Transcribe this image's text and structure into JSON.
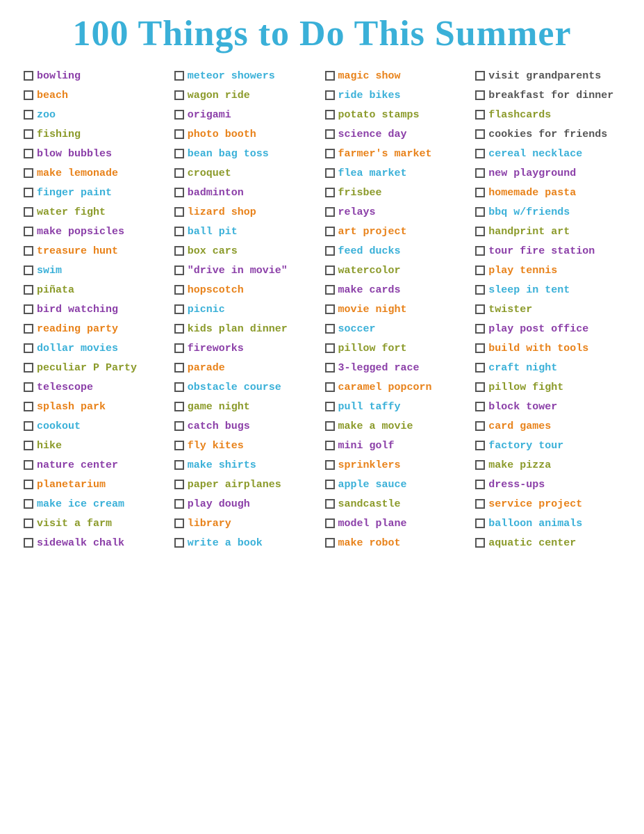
{
  "title": "100 Things to Do This Summer",
  "columns": [
    [
      {
        "label": "bowling",
        "color": "c-purple"
      },
      {
        "label": "beach",
        "color": "c-orange"
      },
      {
        "label": "zoo",
        "color": "c-teal"
      },
      {
        "label": "fishing",
        "color": "c-olive"
      },
      {
        "label": "blow bubbles",
        "color": "c-purple"
      },
      {
        "label": "make lemonade",
        "color": "c-orange"
      },
      {
        "label": "finger paint",
        "color": "c-teal"
      },
      {
        "label": "water fight",
        "color": "c-olive"
      },
      {
        "label": "make popsicles",
        "color": "c-purple"
      },
      {
        "label": "treasure hunt",
        "color": "c-orange"
      },
      {
        "label": "swim",
        "color": "c-teal"
      },
      {
        "label": "piñata",
        "color": "c-olive"
      },
      {
        "label": "bird watching",
        "color": "c-purple"
      },
      {
        "label": "reading party",
        "color": "c-orange"
      },
      {
        "label": "dollar movies",
        "color": "c-teal"
      },
      {
        "label": "peculiar P Party",
        "color": "c-olive"
      },
      {
        "label": "telescope",
        "color": "c-purple"
      },
      {
        "label": "splash park",
        "color": "c-orange"
      },
      {
        "label": "cookout",
        "color": "c-teal"
      },
      {
        "label": "hike",
        "color": "c-olive"
      },
      {
        "label": "nature center",
        "color": "c-purple"
      },
      {
        "label": "planetarium",
        "color": "c-orange"
      },
      {
        "label": "make ice cream",
        "color": "c-teal"
      },
      {
        "label": "visit a farm",
        "color": "c-olive"
      },
      {
        "label": "sidewalk chalk",
        "color": "c-purple"
      }
    ],
    [
      {
        "label": "meteor showers",
        "color": "c-teal"
      },
      {
        "label": "wagon ride",
        "color": "c-olive"
      },
      {
        "label": "origami",
        "color": "c-purple"
      },
      {
        "label": "photo booth",
        "color": "c-orange"
      },
      {
        "label": "bean bag toss",
        "color": "c-teal"
      },
      {
        "label": "croquet",
        "color": "c-olive"
      },
      {
        "label": "badminton",
        "color": "c-purple"
      },
      {
        "label": "lizard shop",
        "color": "c-orange"
      },
      {
        "label": "ball pit",
        "color": "c-teal"
      },
      {
        "label": "box cars",
        "color": "c-olive"
      },
      {
        "label": "\"drive in movie\"",
        "color": "c-purple"
      },
      {
        "label": "hopscotch",
        "color": "c-orange"
      },
      {
        "label": "picnic",
        "color": "c-teal"
      },
      {
        "label": "kids plan dinner",
        "color": "c-olive"
      },
      {
        "label": "fireworks",
        "color": "c-purple"
      },
      {
        "label": "parade",
        "color": "c-orange"
      },
      {
        "label": "obstacle course",
        "color": "c-teal"
      },
      {
        "label": "game night",
        "color": "c-olive"
      },
      {
        "label": "catch bugs",
        "color": "c-purple"
      },
      {
        "label": "fly kites",
        "color": "c-orange"
      },
      {
        "label": "make shirts",
        "color": "c-teal"
      },
      {
        "label": "paper airplanes",
        "color": "c-olive"
      },
      {
        "label": "play dough",
        "color": "c-purple"
      },
      {
        "label": "library",
        "color": "c-orange"
      },
      {
        "label": "write a book",
        "color": "c-teal"
      }
    ],
    [
      {
        "label": "magic show",
        "color": "c-orange"
      },
      {
        "label": "ride bikes",
        "color": "c-teal"
      },
      {
        "label": "potato stamps",
        "color": "c-olive"
      },
      {
        "label": "science day",
        "color": "c-purple"
      },
      {
        "label": "farmer's market",
        "color": "c-orange"
      },
      {
        "label": "flea market",
        "color": "c-teal"
      },
      {
        "label": "frisbee",
        "color": "c-olive"
      },
      {
        "label": "relays",
        "color": "c-purple"
      },
      {
        "label": "art project",
        "color": "c-orange"
      },
      {
        "label": "feed ducks",
        "color": "c-teal"
      },
      {
        "label": "watercolor",
        "color": "c-olive"
      },
      {
        "label": "make cards",
        "color": "c-purple"
      },
      {
        "label": "movie night",
        "color": "c-orange"
      },
      {
        "label": "soccer",
        "color": "c-teal"
      },
      {
        "label": "pillow fort",
        "color": "c-olive"
      },
      {
        "label": "3-legged race",
        "color": "c-purple"
      },
      {
        "label": "caramel popcorn",
        "color": "c-orange"
      },
      {
        "label": "pull taffy",
        "color": "c-teal"
      },
      {
        "label": "make a movie",
        "color": "c-olive"
      },
      {
        "label": "mini golf",
        "color": "c-purple"
      },
      {
        "label": "sprinklers",
        "color": "c-orange"
      },
      {
        "label": "apple sauce",
        "color": "c-teal"
      },
      {
        "label": "sandcastle",
        "color": "c-olive"
      },
      {
        "label": "model plane",
        "color": "c-purple"
      },
      {
        "label": "make robot",
        "color": "c-orange"
      }
    ],
    [
      {
        "label": "visit grandparents",
        "color": "c-darkgray"
      },
      {
        "label": "breakfast for dinner",
        "color": "c-darkgray"
      },
      {
        "label": "flashcards",
        "color": "c-olive"
      },
      {
        "label": "cookies for friends",
        "color": "c-darkgray"
      },
      {
        "label": "cereal necklace",
        "color": "c-teal"
      },
      {
        "label": "new playground",
        "color": "c-purple"
      },
      {
        "label": "homemade pasta",
        "color": "c-orange"
      },
      {
        "label": "bbq w/friends",
        "color": "c-teal"
      },
      {
        "label": "handprint art",
        "color": "c-olive"
      },
      {
        "label": "tour fire station",
        "color": "c-purple"
      },
      {
        "label": "play tennis",
        "color": "c-orange"
      },
      {
        "label": "sleep in tent",
        "color": "c-teal"
      },
      {
        "label": "twister",
        "color": "c-olive"
      },
      {
        "label": "play post office",
        "color": "c-purple"
      },
      {
        "label": "build with tools",
        "color": "c-orange"
      },
      {
        "label": "craft night",
        "color": "c-teal"
      },
      {
        "label": "pillow fight",
        "color": "c-olive"
      },
      {
        "label": "block tower",
        "color": "c-purple"
      },
      {
        "label": "card games",
        "color": "c-orange"
      },
      {
        "label": "factory tour",
        "color": "c-teal"
      },
      {
        "label": "make pizza",
        "color": "c-olive"
      },
      {
        "label": "dress-ups",
        "color": "c-purple"
      },
      {
        "label": "service project",
        "color": "c-orange"
      },
      {
        "label": "balloon animals",
        "color": "c-teal"
      },
      {
        "label": "aquatic center",
        "color": "c-olive"
      }
    ]
  ]
}
